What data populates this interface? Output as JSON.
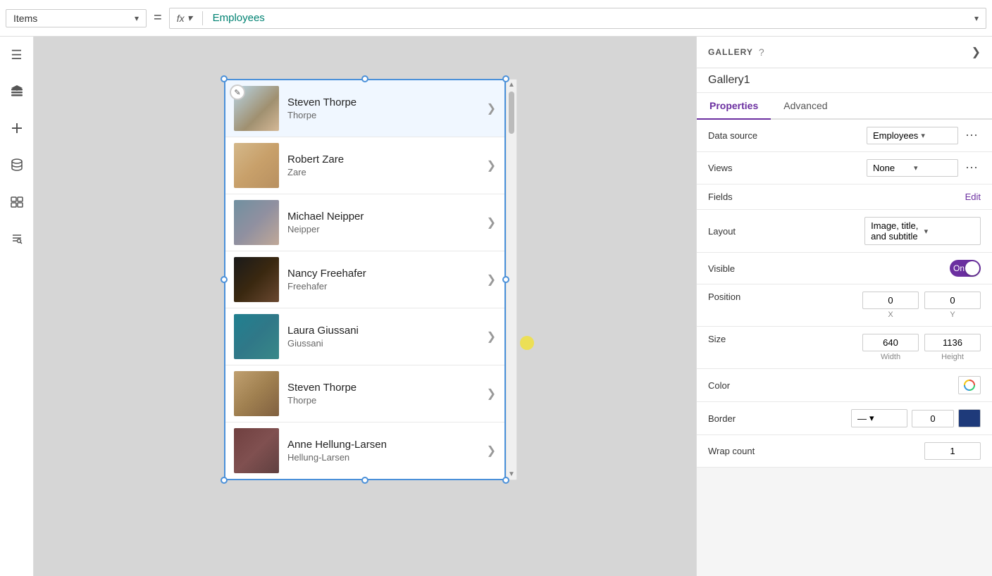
{
  "topbar": {
    "items_label": "Items",
    "chevron": "▾",
    "equals": "=",
    "fx_label": "fx",
    "formula_value": "Employees",
    "formula_chevron": "▾"
  },
  "sidebar": {
    "icons": [
      {
        "name": "menu-icon",
        "symbol": "☰"
      },
      {
        "name": "layers-icon",
        "symbol": "⊞"
      },
      {
        "name": "add-icon",
        "symbol": "+"
      },
      {
        "name": "data-icon",
        "symbol": "⬡"
      },
      {
        "name": "media-icon",
        "symbol": "▦"
      },
      {
        "name": "tools-icon",
        "symbol": "⚙"
      }
    ]
  },
  "gallery": {
    "items": [
      {
        "id": 1,
        "name": "Steven Thorpe",
        "subtitle": "Thorpe",
        "avatarClass": "avatar-steven1",
        "emoji": "👤"
      },
      {
        "id": 2,
        "name": "Robert Zare",
        "subtitle": "Zare",
        "avatarClass": "avatar-robert",
        "emoji": "👤"
      },
      {
        "id": 3,
        "name": "Michael Neipper",
        "subtitle": "Neipper",
        "avatarClass": "avatar-michael",
        "emoji": "👤"
      },
      {
        "id": 4,
        "name": "Nancy Freehafer",
        "subtitle": "Freehafer",
        "avatarClass": "avatar-nancy",
        "emoji": "👤"
      },
      {
        "id": 5,
        "name": "Laura Giussani",
        "subtitle": "Giussani",
        "avatarClass": "avatar-laura",
        "emoji": "👤"
      },
      {
        "id": 6,
        "name": "Steven Thorpe",
        "subtitle": "Thorpe",
        "avatarClass": "avatar-steven2",
        "emoji": "👤"
      },
      {
        "id": 7,
        "name": "Anne Hellung-Larsen",
        "subtitle": "Hellung-Larsen",
        "avatarClass": "avatar-anne",
        "emoji": "👤"
      }
    ]
  },
  "right_panel": {
    "section_label": "GALLERY",
    "help_symbol": "?",
    "expand_symbol": "❯",
    "gallery_name": "Gallery1",
    "tabs": [
      {
        "id": "properties",
        "label": "Properties",
        "active": true
      },
      {
        "id": "advanced",
        "label": "Advanced",
        "active": false
      }
    ],
    "properties": {
      "data_source": {
        "label": "Data source",
        "value": "Employees",
        "more_symbol": "⋯"
      },
      "views": {
        "label": "Views",
        "value": "None",
        "more_symbol": "⋯"
      },
      "fields": {
        "label": "Fields",
        "edit_label": "Edit"
      },
      "layout": {
        "label": "Layout",
        "value": "Image, title, and subtitle"
      },
      "visible": {
        "label": "Visible",
        "on_label": "On"
      },
      "position": {
        "label": "Position",
        "x_value": "0",
        "y_value": "0",
        "x_label": "X",
        "y_label": "Y"
      },
      "size": {
        "label": "Size",
        "width_value": "640",
        "height_value": "1136",
        "width_label": "Width",
        "height_label": "Height"
      },
      "color": {
        "label": "Color",
        "picker_symbol": "🎨"
      },
      "border": {
        "label": "Border",
        "style_symbol": "—",
        "value": "0",
        "color_hex": "#1e3a7a"
      },
      "wrap_count": {
        "label": "Wrap count",
        "value": "1"
      }
    }
  }
}
